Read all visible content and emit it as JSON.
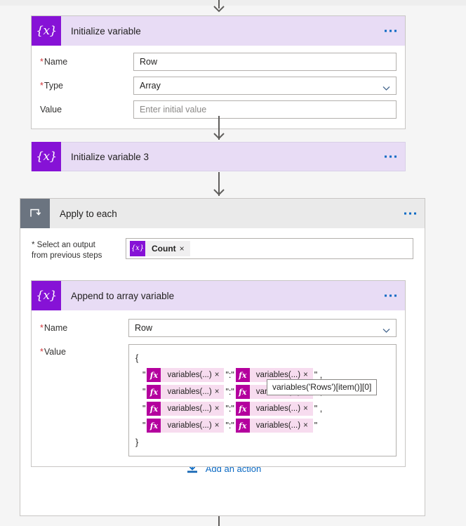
{
  "flow": {
    "cards": {
      "initialize_variable": {
        "title": "Initialize variable",
        "icon": "variable-icon",
        "glyph": "{x}",
        "fields": [
          {
            "label": "Name",
            "required": true,
            "value": "Row",
            "type": "text",
            "placeholder": ""
          },
          {
            "label": "Type",
            "required": true,
            "value": "Array",
            "type": "dropdown",
            "placeholder": ""
          },
          {
            "label": "Value",
            "required": false,
            "value": "",
            "type": "text",
            "placeholder": "Enter initial value"
          }
        ]
      },
      "initialize_variable_3": {
        "title": "Initialize variable 3",
        "icon": "variable-icon",
        "glyph": "{x}",
        "collapsed": true
      },
      "apply_to_each": {
        "title": "Apply to each",
        "icon": "loop-icon",
        "input_label_line1": "* Select an output",
        "input_label_line2": "from previous steps",
        "selected_token": {
          "label": "Count",
          "glyph": "{x}",
          "remove": "×"
        },
        "add_action_label": "Add an action",
        "add_action_icon": "insert-action-icon"
      },
      "append_to_array_variable": {
        "title": "Append to array variable",
        "icon": "variable-icon",
        "glyph": "{x}",
        "name_label": "Name",
        "name_value": "Row",
        "value_label": "Value",
        "value_editor": {
          "open_brace": "{",
          "close_brace": "}",
          "token_label": "variables(...)",
          "token_glyph": "fx",
          "token_remove": "×",
          "rows": [
            {
              "prefix": "\"",
              "separator": "\":\"",
              "suffix": "\" ,"
            },
            {
              "prefix": "\"",
              "separator": "\":\"",
              "suffix": "\" ,"
            },
            {
              "prefix": "\"",
              "separator": "\":\"",
              "suffix": "\" ,"
            },
            {
              "prefix": "\"",
              "separator": "\":\"",
              "suffix": "\""
            }
          ]
        },
        "tooltip": "variables('Rows')[item()][0]"
      }
    }
  },
  "colors": {
    "accent_purple": "#8612d6",
    "card_header_purple": "#e8dcf5",
    "loop_header_gray": "#eaeaea",
    "loop_icon_gray": "#6b7480",
    "link_blue": "#0b6ac4",
    "required_red": "#d13438",
    "fx_magenta": "#b4009e",
    "fx_token_pink": "#f7dcef",
    "canvas_gray": "#f5f5f5"
  }
}
